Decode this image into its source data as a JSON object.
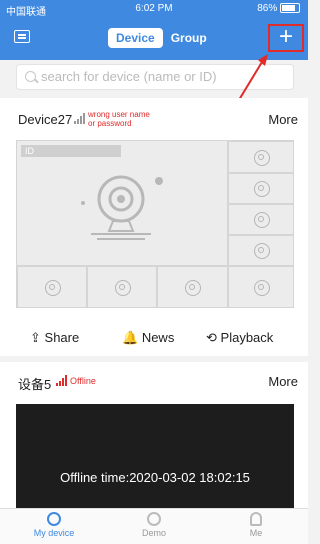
{
  "status": {
    "carrier": "中国联通",
    "time": "6:02 PM",
    "battery": "86%"
  },
  "header": {
    "tab_device": "Device",
    "tab_group": "Group",
    "add": "+"
  },
  "search": {
    "placeholder": "search for device (name or ID)"
  },
  "device1": {
    "name": "Device27",
    "warning_line1": "wrong user name",
    "warning_line2": "or password",
    "more": "More",
    "id_label": "ID"
  },
  "actions": {
    "share": "Share",
    "news": "News",
    "playback": "Playback"
  },
  "device2": {
    "name": "设备5",
    "status": "Offline",
    "more": "More",
    "offline_time": "Offline time:2020-03-02 18:02:15"
  },
  "tabbar": {
    "my_device": "My device",
    "demo": "Demo",
    "me": "Me"
  },
  "colors": {
    "accent": "#3f8ae0",
    "highlight": "#e02b2b"
  }
}
